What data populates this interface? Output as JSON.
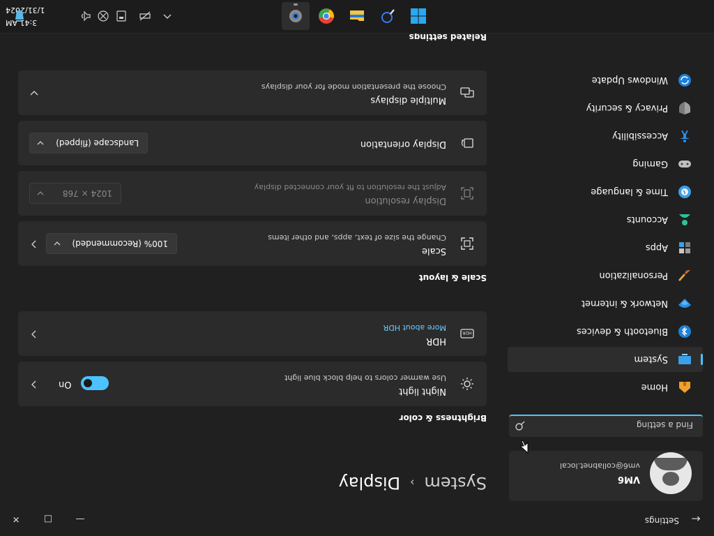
{
  "titlebar": {
    "app_title": "Settings",
    "back_icon": "arrow-left-icon",
    "window_controls": [
      "minimize",
      "maximize",
      "close"
    ]
  },
  "profile": {
    "name": "VM6",
    "email": "vm6@collabnet.local"
  },
  "search": {
    "placeholder": "Find a setting"
  },
  "nav": {
    "items": [
      {
        "label": "Home",
        "icon": "home-icon",
        "active": false
      },
      {
        "label": "System",
        "icon": "system-icon",
        "active": true
      },
      {
        "label": "Bluetooth & devices",
        "icon": "bluetooth-icon",
        "active": false
      },
      {
        "label": "Network & internet",
        "icon": "network-icon",
        "active": false
      },
      {
        "label": "Personalization",
        "icon": "brush-icon",
        "active": false
      },
      {
        "label": "Apps",
        "icon": "apps-icon",
        "active": false
      },
      {
        "label": "Accounts",
        "icon": "accounts-icon",
        "active": false
      },
      {
        "label": "Time & language",
        "icon": "globe-clock-icon",
        "active": false
      },
      {
        "label": "Gaming",
        "icon": "gamepad-icon",
        "active": false
      },
      {
        "label": "Accessibility",
        "icon": "accessibility-icon",
        "active": false
      },
      {
        "label": "Privacy & security",
        "icon": "shield-icon",
        "active": false
      },
      {
        "label": "Windows Update",
        "icon": "update-icon",
        "active": false
      }
    ]
  },
  "breadcrumb": {
    "parent": "System",
    "separator": "›",
    "current": "Display"
  },
  "brightness": {
    "section_title": "Brightness & color",
    "night_light": {
      "title": "Night light",
      "subtitle": "Use warmer colors to help block blue light",
      "state": "On"
    },
    "hdr": {
      "title": "HDR",
      "link": "More about HDR"
    }
  },
  "scale_layout": {
    "section_title": "Scale & layout",
    "scale": {
      "title": "Scale",
      "subtitle": "Change the size of text, apps, and other items",
      "value": "100% (Recommended)"
    },
    "resolution": {
      "title": "Display resolution",
      "subtitle": "Adjust the resolution to fit your connected display",
      "value": "1024 × 768"
    },
    "orientation": {
      "title": "Display orientation",
      "value": "Landscape (flipped)"
    },
    "multiple_displays": {
      "title": "Multiple displays",
      "subtitle": "Choose the presentation mode for your displays"
    }
  },
  "related": {
    "section_title": "Related settings"
  },
  "taskbar": {
    "apps": [
      "windows-start-icon",
      "search-icon",
      "file-explorer-icon",
      "chrome-icon",
      "settings-gear-icon"
    ],
    "tray": [
      "chevron-up-icon",
      "network-icon",
      "display-icon",
      "accessibility-icon",
      "volume-icon",
      "recycle-bin-icon"
    ],
    "time": "3:41 AM",
    "date": "1/31/2024"
  },
  "colors": {
    "accent": "#4cc2ff",
    "background": "#202020",
    "card": "#2b2b2b"
  }
}
